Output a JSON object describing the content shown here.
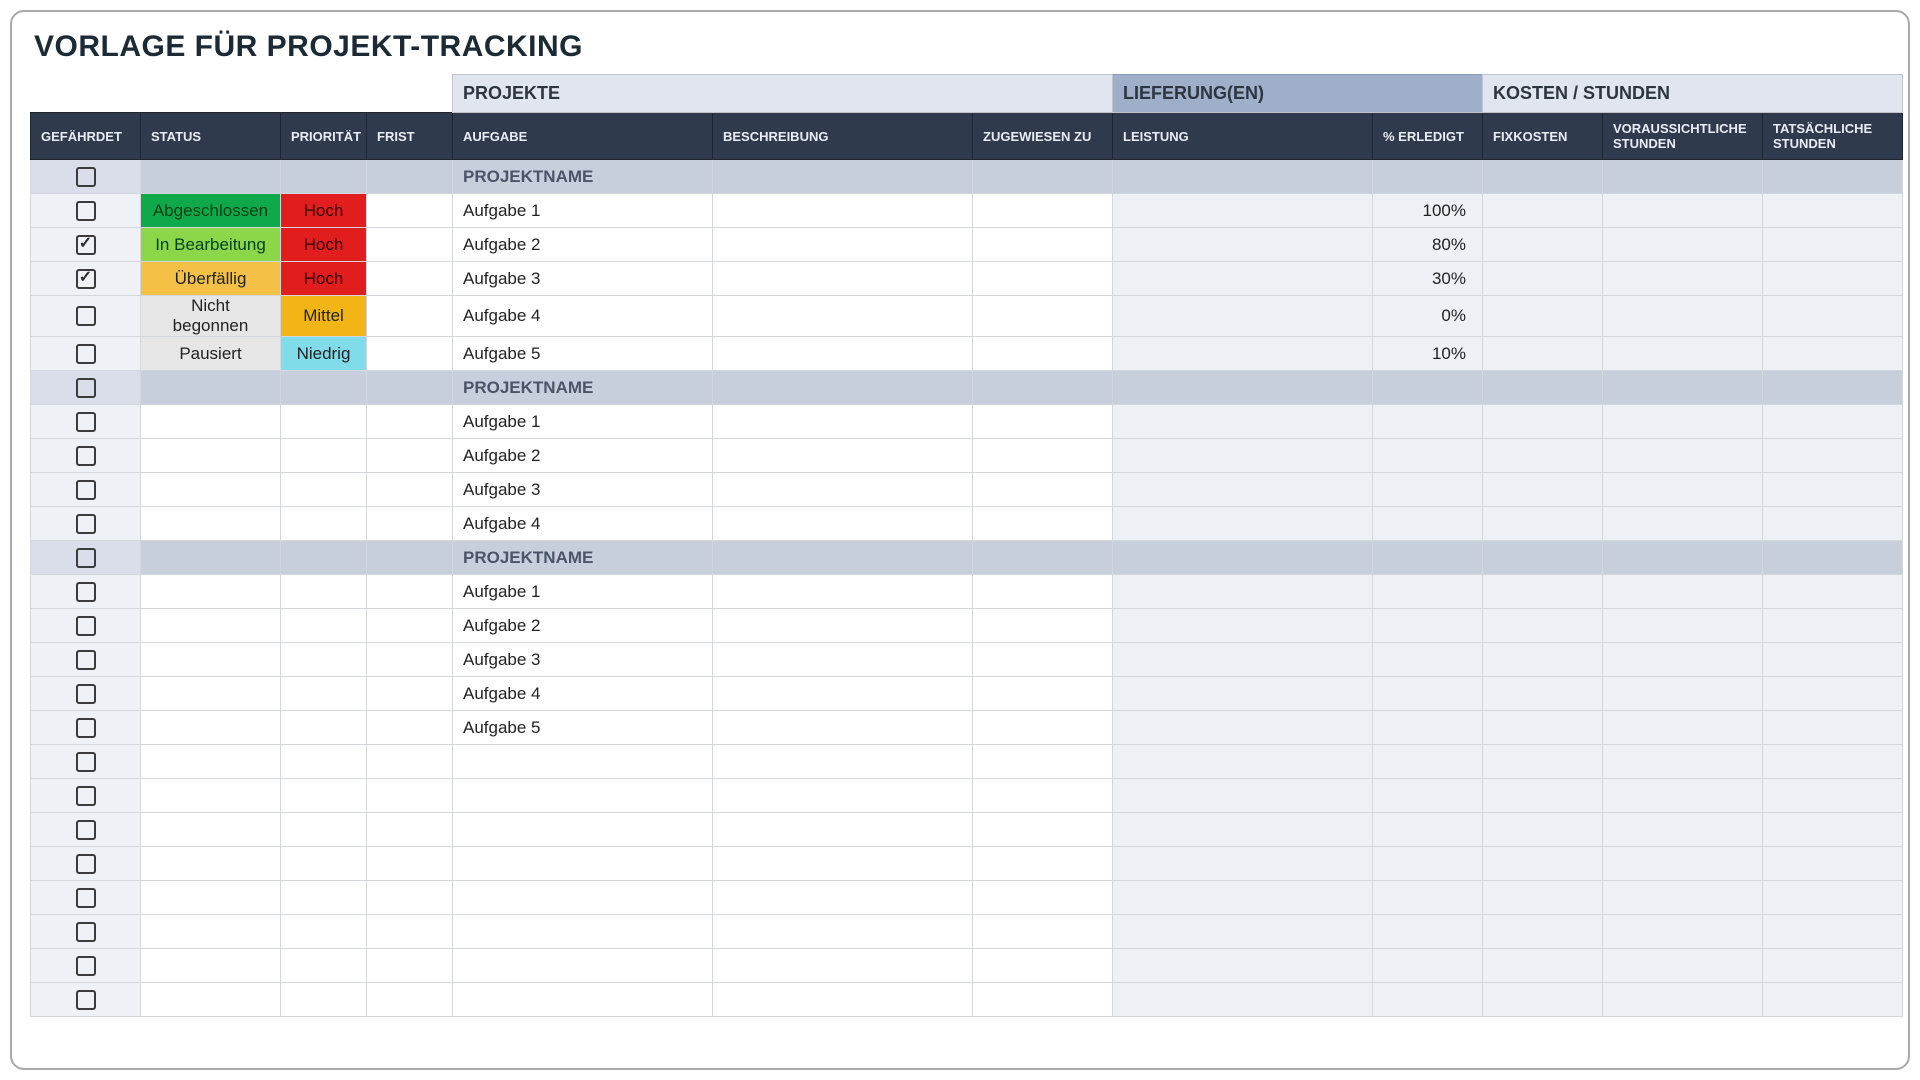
{
  "title": "VORLAGE FÜR PROJEKT-TRACKING",
  "group_headers": {
    "projects": "PROJEKTE",
    "deliveries": "LIEFERUNG(EN)",
    "costs": "KOSTEN / STUNDEN"
  },
  "columns": {
    "gefaehrdet": "GEFÄHRDET",
    "status": "STATUS",
    "prioritaet": "PRIORITÄT",
    "frist": "FRIST",
    "aufgabe": "AUFGABE",
    "beschreibung": "BESCHREIBUNG",
    "zugewiesen_zu": "ZUGEWIESEN ZU",
    "leistung": "LEISTUNG",
    "pct_erledigt": "% ERLEDIGT",
    "fixkosten": "FIXKOSTEN",
    "voraussichtliche_stunden": "VORAUSSICHTLICHE STUNDEN",
    "tatsaechliche_stunden": "TATSÄCHLICHE STUNDEN"
  },
  "status_styles": {
    "Abgeschlossen": "s-abgeschlossen",
    "In Bearbeitung": "s-in-bearbeitung",
    "Überfällig": "s-ueberfaellig",
    "Nicht begonnen": "s-nicht-begonnen",
    "Pausiert": "s-pausiert"
  },
  "priority_styles": {
    "Hoch": "p-hoch",
    "Mittel": "p-mittel",
    "Niedrig": "p-niedrig"
  },
  "rows": [
    {
      "type": "project",
      "checked": false,
      "task": "PROJEKTNAME"
    },
    {
      "type": "task",
      "checked": false,
      "status": "Abgeschlossen",
      "priority": "Hoch",
      "task": "Aufgabe 1",
      "done": "100%"
    },
    {
      "type": "task",
      "checked": true,
      "status": "In Bearbeitung",
      "priority": "Hoch",
      "task": "Aufgabe 2",
      "done": "80%"
    },
    {
      "type": "task",
      "checked": true,
      "status": "Überfällig",
      "priority": "Hoch",
      "task": "Aufgabe 3",
      "done": "30%"
    },
    {
      "type": "task",
      "checked": false,
      "status": "Nicht begonnen",
      "priority": "Mittel",
      "task": "Aufgabe 4",
      "done": "0%"
    },
    {
      "type": "task",
      "checked": false,
      "status": "Pausiert",
      "priority": "Niedrig",
      "task": "Aufgabe 5",
      "done": "10%"
    },
    {
      "type": "project",
      "checked": false,
      "task": "PROJEKTNAME"
    },
    {
      "type": "task",
      "checked": false,
      "task": "Aufgabe 1"
    },
    {
      "type": "task",
      "checked": false,
      "task": "Aufgabe 2"
    },
    {
      "type": "task",
      "checked": false,
      "task": "Aufgabe 3"
    },
    {
      "type": "task",
      "checked": false,
      "task": "Aufgabe 4"
    },
    {
      "type": "project",
      "checked": false,
      "task": "PROJEKTNAME"
    },
    {
      "type": "task",
      "checked": false,
      "task": "Aufgabe 1"
    },
    {
      "type": "task",
      "checked": false,
      "task": "Aufgabe 2"
    },
    {
      "type": "task",
      "checked": false,
      "task": "Aufgabe 3"
    },
    {
      "type": "task",
      "checked": false,
      "task": "Aufgabe 4"
    },
    {
      "type": "task",
      "checked": false,
      "task": "Aufgabe 5"
    },
    {
      "type": "blank"
    },
    {
      "type": "blank"
    },
    {
      "type": "blank"
    },
    {
      "type": "blank"
    },
    {
      "type": "blank"
    },
    {
      "type": "blank"
    },
    {
      "type": "blank"
    },
    {
      "type": "blank"
    }
  ]
}
